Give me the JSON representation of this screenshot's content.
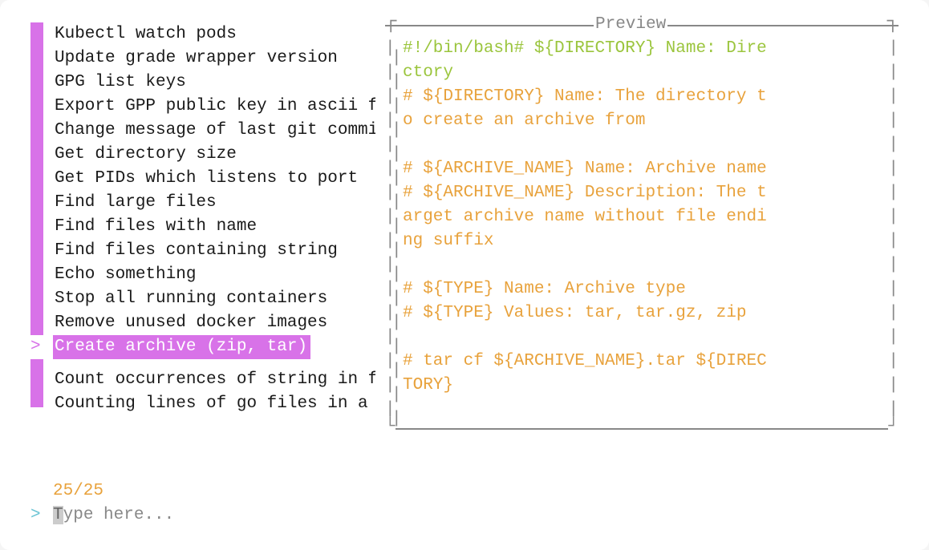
{
  "list": {
    "items": [
      "Kubectl watch pods",
      "Update grade wrapper version",
      "GPG list keys",
      "Export GPP public key in ascii f...",
      "Change message of last git commit",
      "Get directory size",
      "Get PIDs which listens to port",
      "Find large files",
      "Find files with name",
      "Find files containing string",
      "Echo something",
      "Stop all running containers",
      "Remove unused docker images",
      "Create archive (zip, tar)",
      "Count occurrences of string in file",
      "Counting lines of go files in a ..."
    ],
    "selected_index": 13,
    "count": "25/25"
  },
  "prompt": {
    "marker": ">",
    "placeholder_first_char": "T",
    "placeholder_rest": "ype here..."
  },
  "preview": {
    "title": "Preview",
    "lines": [
      {
        "text": "#!/bin/bash# ${DIRECTORY} Name: Dire",
        "cls": "c-green"
      },
      {
        "text": "ctory",
        "cls": "c-green"
      },
      {
        "text": "# ${DIRECTORY} Name: The directory t",
        "cls": "c-orange"
      },
      {
        "text": "o create an archive from",
        "cls": "c-orange"
      },
      {
        "text": "",
        "cls": ""
      },
      {
        "text": "# ${ARCHIVE_NAME} Name: Archive name",
        "cls": "c-orange"
      },
      {
        "text": "# ${ARCHIVE_NAME} Description: The t",
        "cls": "c-orange"
      },
      {
        "text": "arget archive name without file endi",
        "cls": "c-orange"
      },
      {
        "text": "ng suffix",
        "cls": "c-orange"
      },
      {
        "text": "",
        "cls": ""
      },
      {
        "text": "# ${TYPE} Name: Archive type",
        "cls": "c-orange"
      },
      {
        "text": "# ${TYPE} Values: tar, tar.gz, zip",
        "cls": "c-orange"
      },
      {
        "text": "",
        "cls": ""
      },
      {
        "text": "# tar cf ${ARCHIVE_NAME}.tar ${DIREC",
        "cls": "c-orange"
      },
      {
        "text": "TORY}",
        "cls": "c-orange"
      }
    ]
  },
  "colors": {
    "magenta": "#d872e8",
    "green": "#9bc53d",
    "orange": "#e8a23c",
    "gray": "#888888",
    "cyan": "#6bc4d4"
  }
}
